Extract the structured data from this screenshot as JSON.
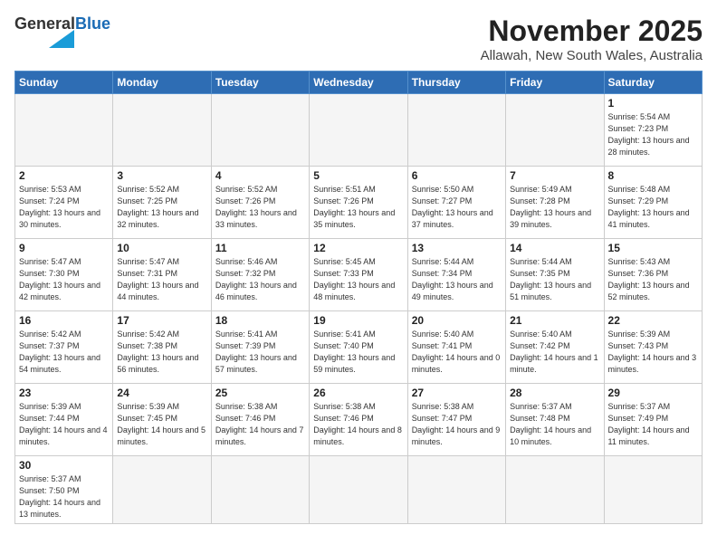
{
  "header": {
    "logo_general": "General",
    "logo_blue": "Blue",
    "month": "November 2025",
    "location": "Allawah, New South Wales, Australia"
  },
  "weekdays": [
    "Sunday",
    "Monday",
    "Tuesday",
    "Wednesday",
    "Thursday",
    "Friday",
    "Saturday"
  ],
  "weeks": [
    [
      {
        "day": "",
        "empty": true
      },
      {
        "day": "",
        "empty": true
      },
      {
        "day": "",
        "empty": true
      },
      {
        "day": "",
        "empty": true
      },
      {
        "day": "",
        "empty": true
      },
      {
        "day": "",
        "empty": true
      },
      {
        "day": "1",
        "sunrise": "Sunrise: 5:54 AM",
        "sunset": "Sunset: 7:23 PM",
        "daylight": "Daylight: 13 hours and 28 minutes."
      }
    ],
    [
      {
        "day": "2",
        "sunrise": "Sunrise: 5:53 AM",
        "sunset": "Sunset: 7:24 PM",
        "daylight": "Daylight: 13 hours and 30 minutes."
      },
      {
        "day": "3",
        "sunrise": "Sunrise: 5:52 AM",
        "sunset": "Sunset: 7:25 PM",
        "daylight": "Daylight: 13 hours and 32 minutes."
      },
      {
        "day": "4",
        "sunrise": "Sunrise: 5:52 AM",
        "sunset": "Sunset: 7:26 PM",
        "daylight": "Daylight: 13 hours and 33 minutes."
      },
      {
        "day": "5",
        "sunrise": "Sunrise: 5:51 AM",
        "sunset": "Sunset: 7:26 PM",
        "daylight": "Daylight: 13 hours and 35 minutes."
      },
      {
        "day": "6",
        "sunrise": "Sunrise: 5:50 AM",
        "sunset": "Sunset: 7:27 PM",
        "daylight": "Daylight: 13 hours and 37 minutes."
      },
      {
        "day": "7",
        "sunrise": "Sunrise: 5:49 AM",
        "sunset": "Sunset: 7:28 PM",
        "daylight": "Daylight: 13 hours and 39 minutes."
      },
      {
        "day": "8",
        "sunrise": "Sunrise: 5:48 AM",
        "sunset": "Sunset: 7:29 PM",
        "daylight": "Daylight: 13 hours and 41 minutes."
      }
    ],
    [
      {
        "day": "9",
        "sunrise": "Sunrise: 5:47 AM",
        "sunset": "Sunset: 7:30 PM",
        "daylight": "Daylight: 13 hours and 42 minutes."
      },
      {
        "day": "10",
        "sunrise": "Sunrise: 5:47 AM",
        "sunset": "Sunset: 7:31 PM",
        "daylight": "Daylight: 13 hours and 44 minutes."
      },
      {
        "day": "11",
        "sunrise": "Sunrise: 5:46 AM",
        "sunset": "Sunset: 7:32 PM",
        "daylight": "Daylight: 13 hours and 46 minutes."
      },
      {
        "day": "12",
        "sunrise": "Sunrise: 5:45 AM",
        "sunset": "Sunset: 7:33 PM",
        "daylight": "Daylight: 13 hours and 48 minutes."
      },
      {
        "day": "13",
        "sunrise": "Sunrise: 5:44 AM",
        "sunset": "Sunset: 7:34 PM",
        "daylight": "Daylight: 13 hours and 49 minutes."
      },
      {
        "day": "14",
        "sunrise": "Sunrise: 5:44 AM",
        "sunset": "Sunset: 7:35 PM",
        "daylight": "Daylight: 13 hours and 51 minutes."
      },
      {
        "day": "15",
        "sunrise": "Sunrise: 5:43 AM",
        "sunset": "Sunset: 7:36 PM",
        "daylight": "Daylight: 13 hours and 52 minutes."
      }
    ],
    [
      {
        "day": "16",
        "sunrise": "Sunrise: 5:42 AM",
        "sunset": "Sunset: 7:37 PM",
        "daylight": "Daylight: 13 hours and 54 minutes."
      },
      {
        "day": "17",
        "sunrise": "Sunrise: 5:42 AM",
        "sunset": "Sunset: 7:38 PM",
        "daylight": "Daylight: 13 hours and 56 minutes."
      },
      {
        "day": "18",
        "sunrise": "Sunrise: 5:41 AM",
        "sunset": "Sunset: 7:39 PM",
        "daylight": "Daylight: 13 hours and 57 minutes."
      },
      {
        "day": "19",
        "sunrise": "Sunrise: 5:41 AM",
        "sunset": "Sunset: 7:40 PM",
        "daylight": "Daylight: 13 hours and 59 minutes."
      },
      {
        "day": "20",
        "sunrise": "Sunrise: 5:40 AM",
        "sunset": "Sunset: 7:41 PM",
        "daylight": "Daylight: 14 hours and 0 minutes."
      },
      {
        "day": "21",
        "sunrise": "Sunrise: 5:40 AM",
        "sunset": "Sunset: 7:42 PM",
        "daylight": "Daylight: 14 hours and 1 minute."
      },
      {
        "day": "22",
        "sunrise": "Sunrise: 5:39 AM",
        "sunset": "Sunset: 7:43 PM",
        "daylight": "Daylight: 14 hours and 3 minutes."
      }
    ],
    [
      {
        "day": "23",
        "sunrise": "Sunrise: 5:39 AM",
        "sunset": "Sunset: 7:44 PM",
        "daylight": "Daylight: 14 hours and 4 minutes."
      },
      {
        "day": "24",
        "sunrise": "Sunrise: 5:39 AM",
        "sunset": "Sunset: 7:45 PM",
        "daylight": "Daylight: 14 hours and 5 minutes."
      },
      {
        "day": "25",
        "sunrise": "Sunrise: 5:38 AM",
        "sunset": "Sunset: 7:46 PM",
        "daylight": "Daylight: 14 hours and 7 minutes."
      },
      {
        "day": "26",
        "sunrise": "Sunrise: 5:38 AM",
        "sunset": "Sunset: 7:46 PM",
        "daylight": "Daylight: 14 hours and 8 minutes."
      },
      {
        "day": "27",
        "sunrise": "Sunrise: 5:38 AM",
        "sunset": "Sunset: 7:47 PM",
        "daylight": "Daylight: 14 hours and 9 minutes."
      },
      {
        "day": "28",
        "sunrise": "Sunrise: 5:37 AM",
        "sunset": "Sunset: 7:48 PM",
        "daylight": "Daylight: 14 hours and 10 minutes."
      },
      {
        "day": "29",
        "sunrise": "Sunrise: 5:37 AM",
        "sunset": "Sunset: 7:49 PM",
        "daylight": "Daylight: 14 hours and 11 minutes."
      }
    ],
    [
      {
        "day": "30",
        "sunrise": "Sunrise: 5:37 AM",
        "sunset": "Sunset: 7:50 PM",
        "daylight": "Daylight: 14 hours and 13 minutes."
      },
      {
        "day": "",
        "empty": true
      },
      {
        "day": "",
        "empty": true
      },
      {
        "day": "",
        "empty": true
      },
      {
        "day": "",
        "empty": true
      },
      {
        "day": "",
        "empty": true
      },
      {
        "day": "",
        "empty": true
      }
    ]
  ]
}
